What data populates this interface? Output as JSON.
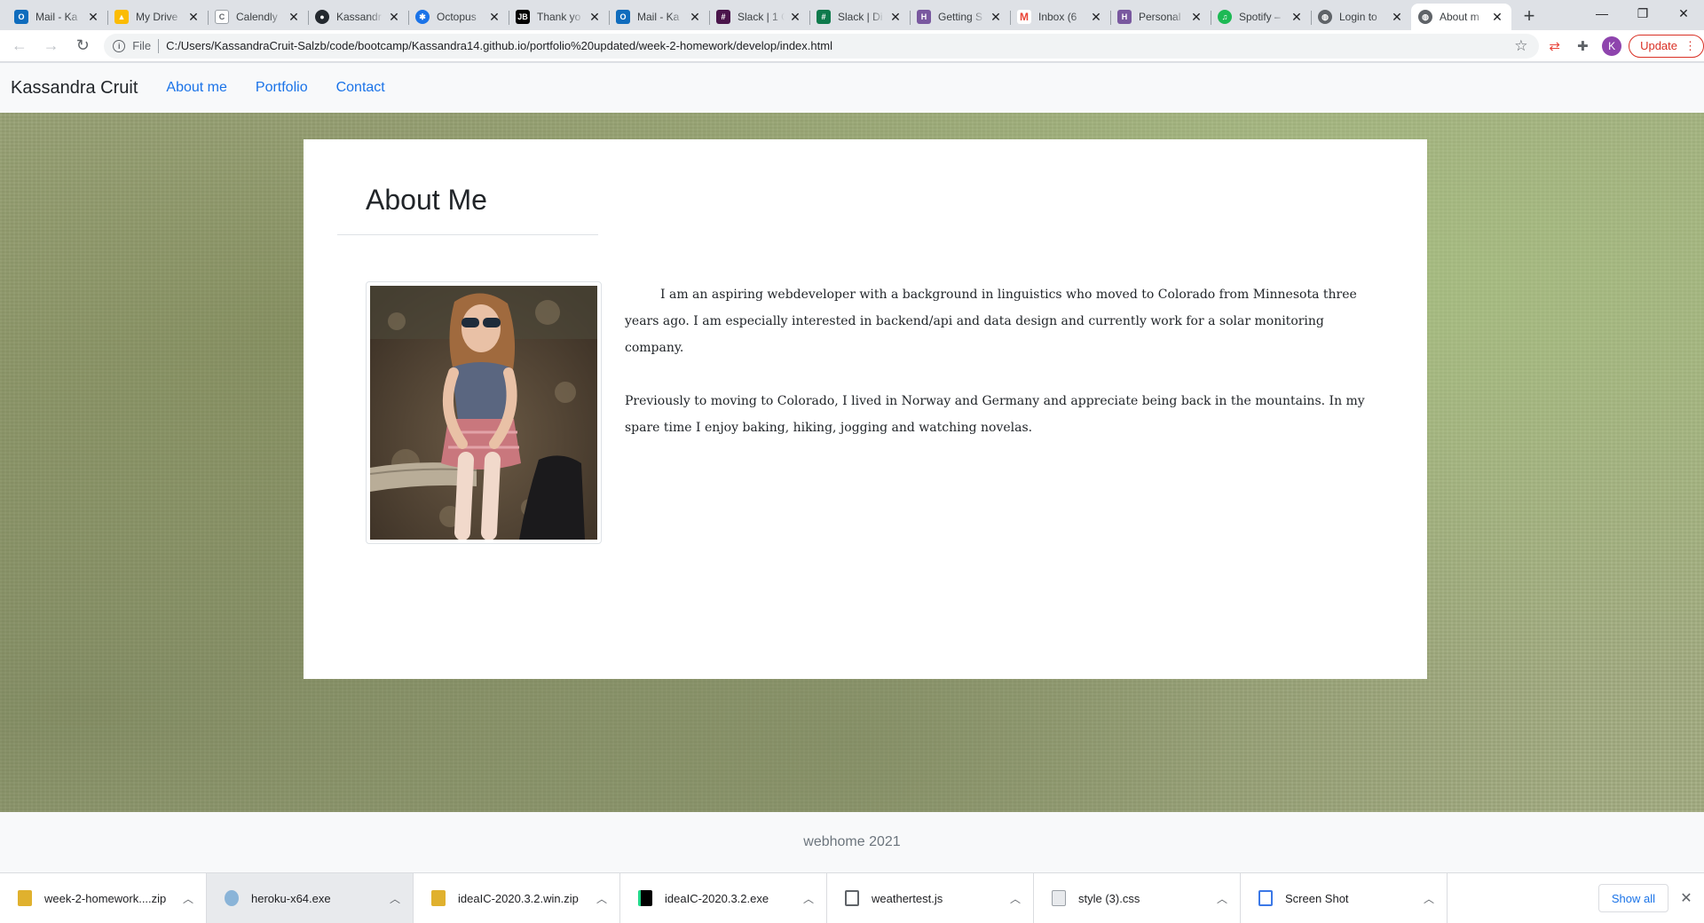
{
  "browser": {
    "tabs": [
      {
        "title": "Mail - Ka",
        "icon": "outlook-icon",
        "color": "#0f6cbd",
        "glyph": "O"
      },
      {
        "title": "My Drive",
        "icon": "google-drive-icon",
        "color": "#fbbc04",
        "glyph": "▲"
      },
      {
        "title": "Calendly",
        "icon": "calendly-icon",
        "color": "#9aa0a6",
        "glyph": "C"
      },
      {
        "title": "Kassandr",
        "icon": "github-icon",
        "color": "#24292f",
        "glyph": "●"
      },
      {
        "title": "Octopus",
        "icon": "octopus-icon",
        "color": "#1a73e8",
        "glyph": "✱"
      },
      {
        "title": "Thank yo",
        "icon": "jetbrains-icon",
        "color": "#000000",
        "glyph": "JB"
      },
      {
        "title": "Mail - Ka",
        "icon": "outlook-icon",
        "color": "#0f6cbd",
        "glyph": "O"
      },
      {
        "title": "Slack | 1 C",
        "icon": "slack-icon",
        "color": "#4a154b",
        "glyph": "#"
      },
      {
        "title": "Slack | Di",
        "icon": "slack-icon",
        "color": "#0e7a4c",
        "glyph": "#"
      },
      {
        "title": "Getting S",
        "icon": "heroku-icon",
        "color": "#79589f",
        "glyph": "H"
      },
      {
        "title": "Inbox (6",
        "icon": "gmail-icon",
        "color": "#ea4335",
        "glyph": "M"
      },
      {
        "title": "Personal",
        "icon": "heroku-icon",
        "color": "#79589f",
        "glyph": "H"
      },
      {
        "title": "Spotify –",
        "icon": "spotify-icon",
        "color": "#1db954",
        "glyph": "♫"
      },
      {
        "title": "Login to",
        "icon": "globe-icon",
        "color": "#5f6368",
        "glyph": "◍"
      },
      {
        "title": "About m",
        "icon": "globe-icon",
        "color": "#5f6368",
        "glyph": "◍"
      }
    ],
    "new_tab_label": "+",
    "scheme_label": "File",
    "url": "C:/Users/KassandraCruit-Salzb/code/bootcamp/Kassandra14.github.io/portfolio%20updated/week-2-homework/develop/index.html",
    "profile_initial": "K",
    "update_label": "Update"
  },
  "site": {
    "brand": "Kassandra Cruit",
    "nav": [
      "About me",
      "Portfolio",
      "Contact"
    ],
    "heading": "About Me",
    "bio": [
      "I am an aspiring webdeveloper with a background in linguistics who moved to Colorado from Minnesota three years ago. I am especially interested in backend/api and data design and currently work for a solar monitoring company.",
      "Previously to moving to Colorado, I lived in Norway and Germany and appreciate being back in the mountains. In my spare time I enjoy baking, hiking, jogging and watching novelas."
    ],
    "footer": "webhome 2021"
  },
  "downloads": {
    "items": [
      {
        "name": "week-2-homework....zip",
        "icon": "zip-file-icon",
        "color": "#e0b12e"
      },
      {
        "name": "heroku-x64.exe",
        "icon": "installer-icon",
        "color": "#8ab4d8"
      },
      {
        "name": "ideaIC-2020.3.2.win.zip",
        "icon": "zip-file-icon",
        "color": "#e0b12e"
      },
      {
        "name": "ideaIC-2020.3.2.exe",
        "icon": "intellij-icon",
        "color": "#000000"
      },
      {
        "name": "weathertest.js",
        "icon": "js-file-icon",
        "color": "#c6a700"
      },
      {
        "name": "style (3).css",
        "icon": "css-file-icon",
        "color": "#9aa0a6"
      },
      {
        "name": "Screen Shot",
        "icon": "document-icon",
        "color": "#3b78e7"
      }
    ],
    "show_all_label": "Show all"
  }
}
